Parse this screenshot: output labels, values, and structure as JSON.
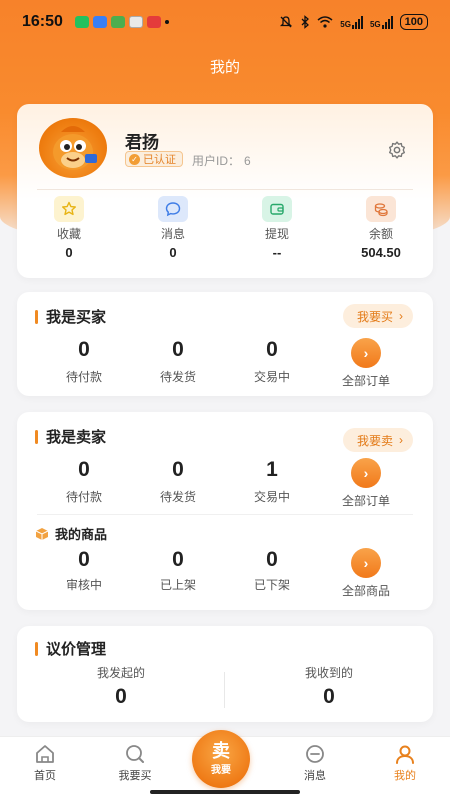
{
  "status_bar": {
    "time": "16:50",
    "signal_a": "5G",
    "signal_b": "5G",
    "battery": "100"
  },
  "header": {
    "title": "我的"
  },
  "profile": {
    "name": "君扬",
    "verified_label": "已认证",
    "user_id_label": "用户ID：",
    "user_id": "6",
    "stats": [
      {
        "label": "收藏",
        "value": "0",
        "icon": "star-icon"
      },
      {
        "label": "消息",
        "value": "0",
        "icon": "message-icon"
      },
      {
        "label": "提现",
        "value": "--",
        "icon": "wallet-icon"
      },
      {
        "label": "余额",
        "value": "504.50",
        "icon": "coins-icon"
      }
    ]
  },
  "buyer": {
    "title": "我是买家",
    "action": "我要买",
    "counters": [
      {
        "label": "待付款",
        "value": "0"
      },
      {
        "label": "待发货",
        "value": "0"
      },
      {
        "label": "交易中",
        "value": "0"
      }
    ],
    "all_orders": "全部订单"
  },
  "seller": {
    "title": "我是卖家",
    "action": "我要卖",
    "counters": [
      {
        "label": "待付款",
        "value": "0"
      },
      {
        "label": "待发货",
        "value": "0"
      },
      {
        "label": "交易中",
        "value": "1"
      }
    ],
    "all_orders": "全部订单",
    "products": {
      "title": "我的商品",
      "counters": [
        {
          "label": "审核中",
          "value": "0"
        },
        {
          "label": "已上架",
          "value": "0"
        },
        {
          "label": "已下架",
          "value": "0"
        }
      ],
      "all_products": "全部商品"
    }
  },
  "bargain": {
    "title": "议价管理",
    "initiated_label": "我发起的",
    "initiated_value": "0",
    "received_label": "我收到的",
    "received_value": "0"
  },
  "nav": {
    "home": "首页",
    "buy": "我要买",
    "sell_big": "卖",
    "sell_small": "我要",
    "messages": "消息",
    "mine": "我的"
  },
  "colors": {
    "accent": "#f08a22",
    "header_orange": "#f7822a",
    "active_nav": "#e8811d"
  }
}
